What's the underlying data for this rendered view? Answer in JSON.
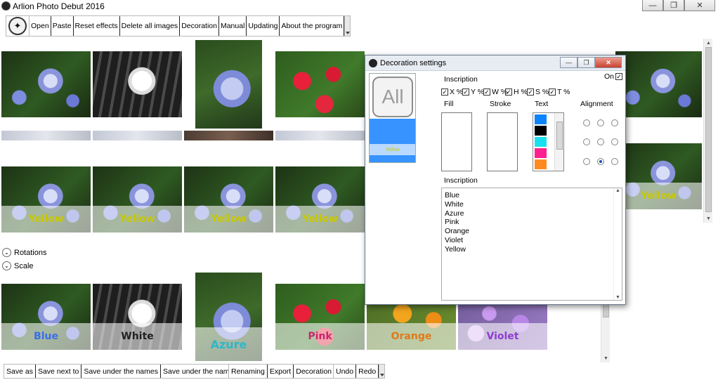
{
  "app": {
    "title": "Arlion Photo Debut 2016"
  },
  "window_controls": {
    "minimize": "—",
    "restore": "❐",
    "close": "✕"
  },
  "toolbar": {
    "items": [
      "Open",
      "Paste",
      "Reset effects",
      "Delete all images",
      "Decoration",
      "Manual",
      "Updating",
      "About the program"
    ]
  },
  "sections": {
    "rotations": "Rotations",
    "scale": "Scale"
  },
  "captions": {
    "row2": [
      "Yellow",
      "Yellow",
      "Yellow",
      "Yellow"
    ],
    "row2_right": "Yellow",
    "row3": [
      "Blue",
      "White",
      "Azure",
      "Pink",
      "Orange",
      "Violet"
    ]
  },
  "caption_colors": {
    "Blue": "#3a6ee8",
    "White": "#222222",
    "Azure": "#2db8c8",
    "Pink": "#c8286e",
    "Orange": "#e07a18",
    "Violet": "#8e3cd2",
    "Yellow": "#c9c900"
  },
  "bottom_bar": {
    "group1": [
      "Save as",
      "Save next to",
      "Save under the names",
      "Save under the names as"
    ],
    "group2": [
      "Renaming",
      "Export",
      "Decoration"
    ],
    "group3": [
      "Undo",
      "Redo"
    ]
  },
  "decoration_dialog": {
    "title": "Decoration settings",
    "on_label": "On",
    "inscription_label": "Inscription",
    "checkboxes": [
      "X %",
      "Y %",
      "W %",
      "H %",
      "S %",
      "T %"
    ],
    "preset_label": "All",
    "preset_caption": "Yellow",
    "columns": {
      "fill": "Fill",
      "stroke": "Stroke",
      "text": "Text",
      "alignment": "Alignment"
    },
    "palette": [
      "#0a84ff",
      "#000000",
      "#19e0f0",
      "#ff1f8f",
      "#ff8a1f"
    ],
    "list_label": "Inscription",
    "list_items": [
      "Blue",
      "White",
      "Azure",
      "Pink",
      "Orange",
      "Violet",
      "Yellow"
    ]
  }
}
